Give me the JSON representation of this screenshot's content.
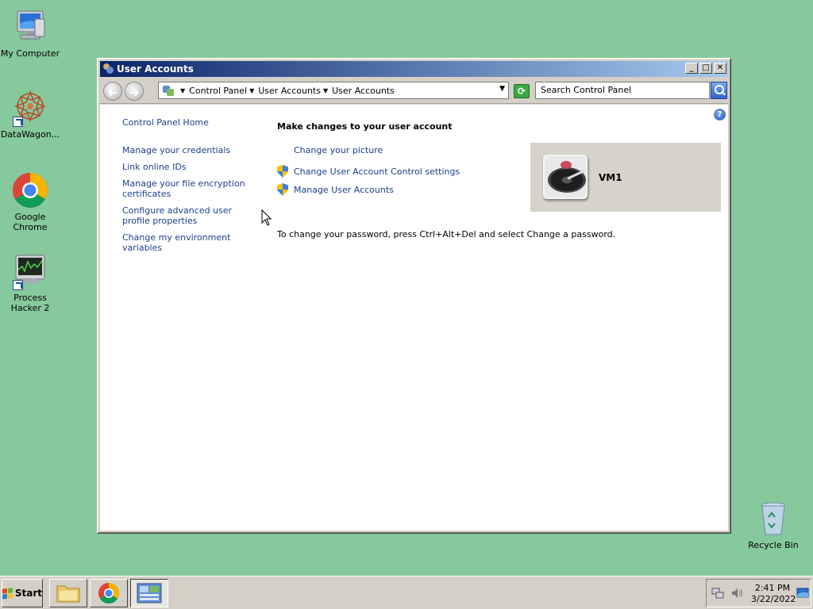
{
  "desktop": {
    "icons": [
      {
        "label": "My Computer"
      },
      {
        "label": "DataWagon..."
      },
      {
        "label": "Google Chrome"
      },
      {
        "label": "Process Hacker 2"
      },
      {
        "label": "Recycle Bin"
      }
    ]
  },
  "window": {
    "title": "User Accounts",
    "buttons": {
      "minimize": "_",
      "maximize": "□",
      "close": "✕"
    },
    "address": {
      "crumbs": [
        "Control Panel",
        "User Accounts",
        "User Accounts"
      ]
    },
    "search": {
      "placeholder": "Search Control Panel"
    },
    "help": "?",
    "sidebar": {
      "home": "Control Panel Home",
      "links": [
        "Manage your credentials",
        "Link online IDs",
        "Manage your file encryption certificates",
        "Configure advanced user profile properties",
        "Change my environment variables"
      ]
    },
    "main": {
      "heading": "Make changes to your user account",
      "tasks": [
        {
          "label": "Change your picture",
          "icon": "none"
        },
        {
          "label": "Change User Account Control settings",
          "icon": "uac-shield-icon"
        },
        {
          "label": "Manage User Accounts",
          "icon": "uac-shield-icon"
        }
      ],
      "info": "To change your password, press Ctrl+Alt+Del and select Change a password."
    },
    "user": {
      "name": "VM1"
    }
  },
  "taskbar": {
    "start": "Start",
    "time": "2:41 PM",
    "date": "3/22/2022"
  },
  "colors": {
    "desktop": "#86c99c",
    "link": "#1a3f8f",
    "title_gradient_start": "#0a246a",
    "title_gradient_end": "#a6caf0"
  }
}
